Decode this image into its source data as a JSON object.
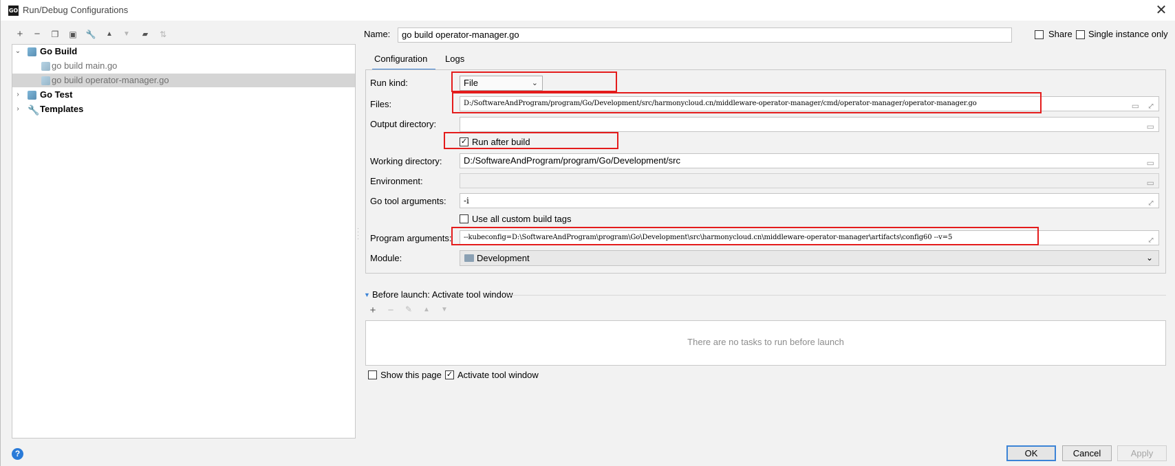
{
  "window": {
    "title": "Run/Debug Configurations",
    "app_icon": "GO",
    "close": "✕"
  },
  "toolbar": [
    {
      "icon": "add-icon",
      "glyph": "+",
      "enabled": true
    },
    {
      "icon": "remove-icon",
      "glyph": "−",
      "enabled": true
    },
    {
      "icon": "copy-icon",
      "glyph": "❐",
      "enabled": true
    },
    {
      "icon": "save-icon",
      "glyph": "▣",
      "enabled": true
    },
    {
      "icon": "wrench-icon",
      "glyph": "🔧",
      "enabled": true
    },
    {
      "icon": "move-up-icon",
      "glyph": "▲",
      "enabled": true
    },
    {
      "icon": "move-down-icon",
      "glyph": "▼",
      "enabled": false
    },
    {
      "icon": "new-folder-icon",
      "glyph": "▰",
      "enabled": true
    },
    {
      "icon": "sort-icon",
      "glyph": "⇅",
      "enabled": false
    }
  ],
  "tree": {
    "go_build": "Go Build",
    "main": "go build main.go",
    "operator": "go build operator-manager.go",
    "go_test": "Go Test",
    "templates": "Templates"
  },
  "name": {
    "label": "Name:",
    "value": "go build operator-manager.go"
  },
  "share": {
    "label": "Share",
    "checked": false
  },
  "single_instance": {
    "label": "Single instance only",
    "checked": false
  },
  "tabs": {
    "configuration": "Configuration",
    "logs": "Logs"
  },
  "form": {
    "run_kind_label": "Run kind:",
    "run_kind_value": "File",
    "files_label": "Files:",
    "files_value": "D:/SoftwareAndProgram/program/Go/Development/src/harmonycloud.cn/middleware-operator-manager/cmd/operator-manager/operator-manager.go",
    "output_dir_label": "Output directory:",
    "output_dir_value": "",
    "run_after_build_label": "Run after build",
    "run_after_build_checked": true,
    "working_dir_label": "Working directory:",
    "working_dir_value": "D:/SoftwareAndProgram/program/Go/Development/src",
    "environment_label": "Environment:",
    "environment_value": "",
    "go_tool_args_label": "Go tool arguments:",
    "go_tool_args_value": "-i",
    "custom_tags_label": "Use all custom build tags",
    "custom_tags_checked": false,
    "program_args_label": "Program arguments:",
    "program_args_value": "--kubeconfig=D:\\SoftwareAndProgram\\program\\Go\\Development\\src\\harmonycloud.cn\\middleware-operator-manager\\artifacts\\config60 --v=5",
    "module_label": "Module:",
    "module_value": "Development"
  },
  "before_launch": {
    "title": "Before launch: Activate tool window",
    "empty_text": "There are no tasks to run before launch"
  },
  "show_page": {
    "label": "Show this page",
    "checked": false
  },
  "activate_tool": {
    "label": "Activate tool window",
    "checked": true
  },
  "buttons": {
    "ok": "OK",
    "cancel": "Cancel",
    "apply": "Apply"
  },
  "colors": {
    "highlight": "#e41b1b",
    "accent": "#3b83d6",
    "selection": "#d5d5d5"
  }
}
